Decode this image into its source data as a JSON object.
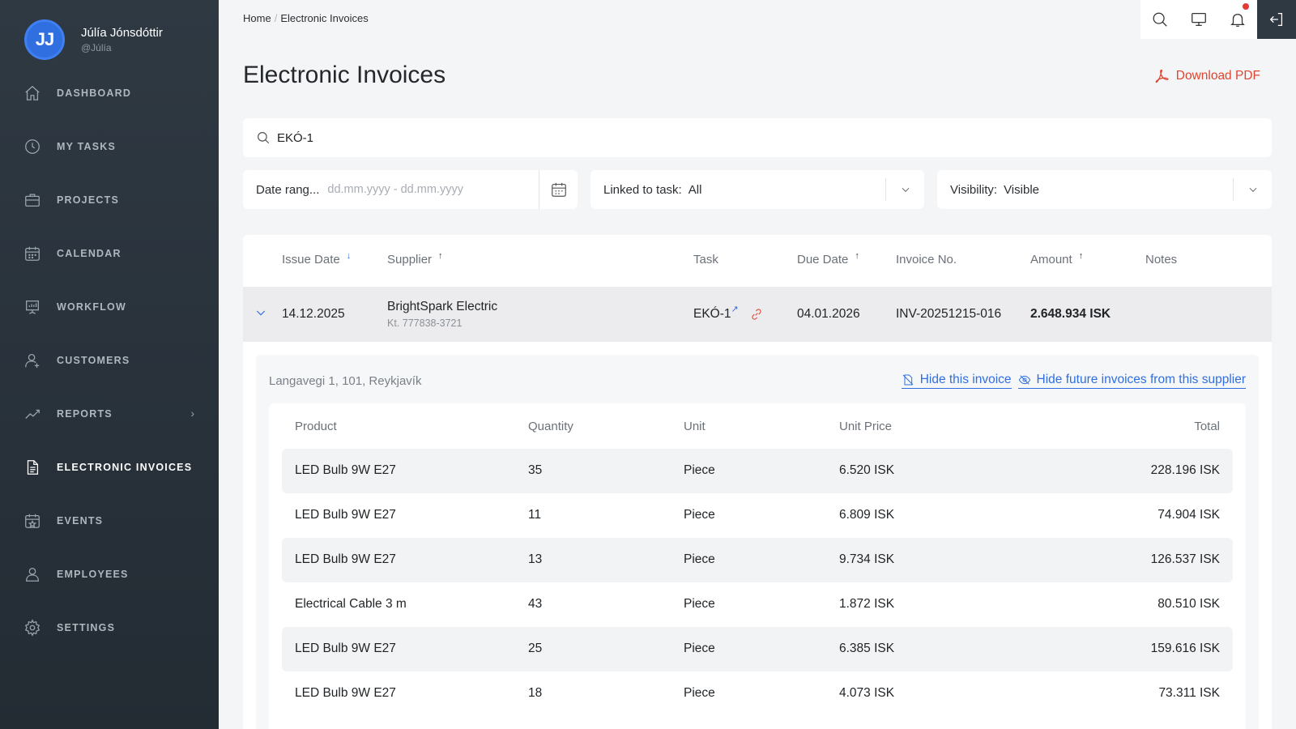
{
  "user": {
    "initials": "JJ",
    "name": "Júlía Jónsdóttir",
    "handle": "@Júlía"
  },
  "nav": [
    {
      "label": "DASHBOARD",
      "icon": "home-icon"
    },
    {
      "label": "MY TASKS",
      "icon": "clock-icon"
    },
    {
      "label": "PROJECTS",
      "icon": "briefcase-icon"
    },
    {
      "label": "CALENDAR",
      "icon": "calendar-icon"
    },
    {
      "label": "WORKFLOW",
      "icon": "presentation-icon"
    },
    {
      "label": "CUSTOMERS",
      "icon": "user-icon"
    },
    {
      "label": "REPORTS",
      "icon": "trend-icon"
    },
    {
      "label": "ELECTRONIC INVOICES",
      "icon": "document-icon"
    },
    {
      "label": "EVENTS",
      "icon": "calendar-star-icon"
    },
    {
      "label": "EMPLOYEES",
      "icon": "users-icon"
    },
    {
      "label": "SETTINGS",
      "icon": "gear-icon"
    }
  ],
  "breadcrumb": {
    "home": "Home",
    "sep": "/",
    "current": "Electronic Invoices"
  },
  "page": {
    "title": "Electronic Invoices",
    "download_label": "Download PDF"
  },
  "search": {
    "value": "EKÓ-1"
  },
  "filters": {
    "date_label": "Date rang...",
    "date_placeholder": "dd.mm.yyyy  -  dd.mm.yyyy",
    "linked_label": "Linked to task:",
    "linked_value": "All",
    "visibility_label": "Visibility:",
    "visibility_value": "Visible"
  },
  "table": {
    "headers": {
      "issue_date": "Issue Date",
      "supplier": "Supplier",
      "task": "Task",
      "due_date": "Due Date",
      "invoice_no": "Invoice No.",
      "amount": "Amount",
      "notes": "Notes"
    },
    "sort_arrows": {
      "down": "↓",
      "up": "↑"
    },
    "row": {
      "issue_date": "14.12.2025",
      "supplier": "BrightSpark Electric",
      "supplier_sub": "Kt. 777838-3721",
      "task": "EKÓ-1",
      "due_date": "04.01.2026",
      "invoice_no": "INV-20251215-016",
      "amount": "2.648.934 ISK"
    }
  },
  "detail": {
    "address": "Langavegi 1, 101, Reykjavík",
    "hide_invoice": "Hide this invoice",
    "hide_future": "Hide future invoices from this supplier",
    "columns": {
      "product": "Product",
      "quantity": "Quantity",
      "unit": "Unit",
      "unit_price": "Unit Price",
      "total": "Total"
    },
    "items": [
      {
        "product": "LED Bulb 9W E27",
        "quantity": "35",
        "unit": "Piece",
        "unit_price": "6.520 ISK",
        "total": "228.196 ISK"
      },
      {
        "product": "LED Bulb 9W E27",
        "quantity": "11",
        "unit": "Piece",
        "unit_price": "6.809 ISK",
        "total": "74.904 ISK"
      },
      {
        "product": "LED Bulb 9W E27",
        "quantity": "13",
        "unit": "Piece",
        "unit_price": "9.734 ISK",
        "total": "126.537 ISK"
      },
      {
        "product": "Electrical Cable 3 m",
        "quantity": "43",
        "unit": "Piece",
        "unit_price": "1.872 ISK",
        "total": "80.510 ISK"
      },
      {
        "product": "LED Bulb 9W E27",
        "quantity": "25",
        "unit": "Piece",
        "unit_price": "6.385 ISK",
        "total": "159.616 ISK"
      },
      {
        "product": "LED Bulb 9W E27",
        "quantity": "18",
        "unit": "Piece",
        "unit_price": "4.073 ISK",
        "total": "73.311 ISK"
      }
    ]
  },
  "colors": {
    "accent": "#2f6fe0",
    "danger": "#e0452f",
    "sidebar": "#2f3942"
  }
}
